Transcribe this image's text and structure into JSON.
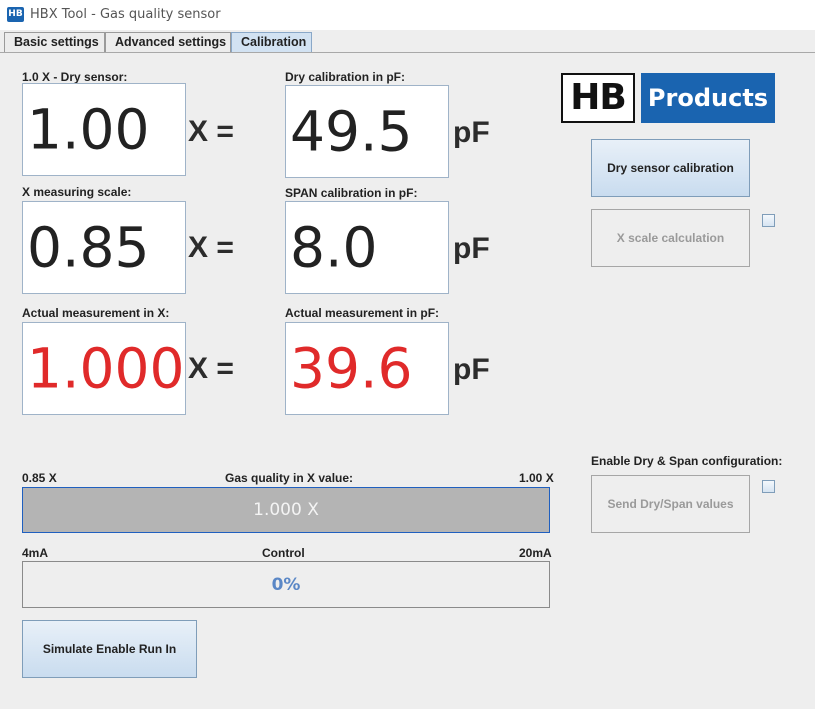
{
  "window": {
    "icon_text": "HB",
    "title": "HBX Tool - Gas quality sensor"
  },
  "tabs": [
    {
      "label": "Basic settings"
    },
    {
      "label": "Advanced settings"
    },
    {
      "label": "Calibration"
    }
  ],
  "dry_sensor": {
    "label": "1.0 X - Dry sensor:",
    "value": "1.00",
    "unit": "X ="
  },
  "dry_calibration": {
    "label": "Dry calibration in pF:",
    "value": "49.5",
    "unit": "pF"
  },
  "x_scale": {
    "label": "X measuring scale:",
    "value": "0.85",
    "unit": "X ="
  },
  "span_calibration": {
    "label": "SPAN calibration in pF:",
    "value": "8.0",
    "unit": "pF"
  },
  "actual_x": {
    "label": "Actual measurement in X:",
    "value": "1.000",
    "unit": "X ="
  },
  "actual_pf": {
    "label": "Actual measurement in pF:",
    "value": "39.6",
    "unit": "pF"
  },
  "logo": {
    "left": "HB",
    "right": "Products"
  },
  "buttons": {
    "dry_sensor_calibration": "Dry sensor calibration",
    "x_scale_calculation": "X scale calculation",
    "send_dry_span": "Send Dry/Span values",
    "simulate_run_in": "Simulate Enable Run In"
  },
  "enable_dry_span_label": "Enable Dry & Span configuration:",
  "gas_quality": {
    "min": "0.85 X",
    "title": "Gas quality in X value:",
    "max": "1.00 X",
    "value_text": "1.000 X"
  },
  "control": {
    "min": "4mA",
    "title": "Control",
    "max": "20mA",
    "value_text": "0%",
    "percent": 0
  },
  "colors": {
    "accent": "#1a64b0",
    "alarm_value": "#e02a2a",
    "tab_active": "#d2e2f2"
  }
}
